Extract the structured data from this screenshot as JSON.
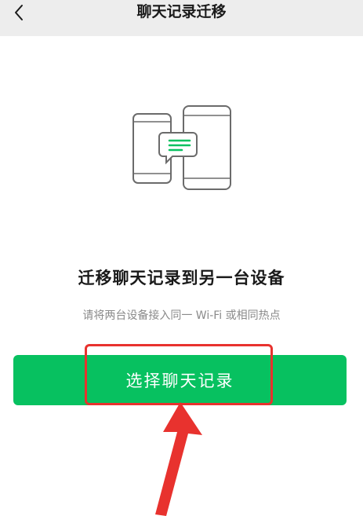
{
  "nav": {
    "title": "聊天记录迁移",
    "back_icon": "chevron-left-icon"
  },
  "illustration": {
    "icon": "phones-transfer-icon",
    "accent_color": "#07c160"
  },
  "content": {
    "title": "迁移聊天记录到另一台设备",
    "subtitle": "请将两台设备接入同一 Wi-Fi 或相同热点"
  },
  "actions": {
    "select_button_label": "选择聊天记录",
    "button_color": "#07c160"
  },
  "annotation": {
    "highlight_color": "#e8322e"
  }
}
